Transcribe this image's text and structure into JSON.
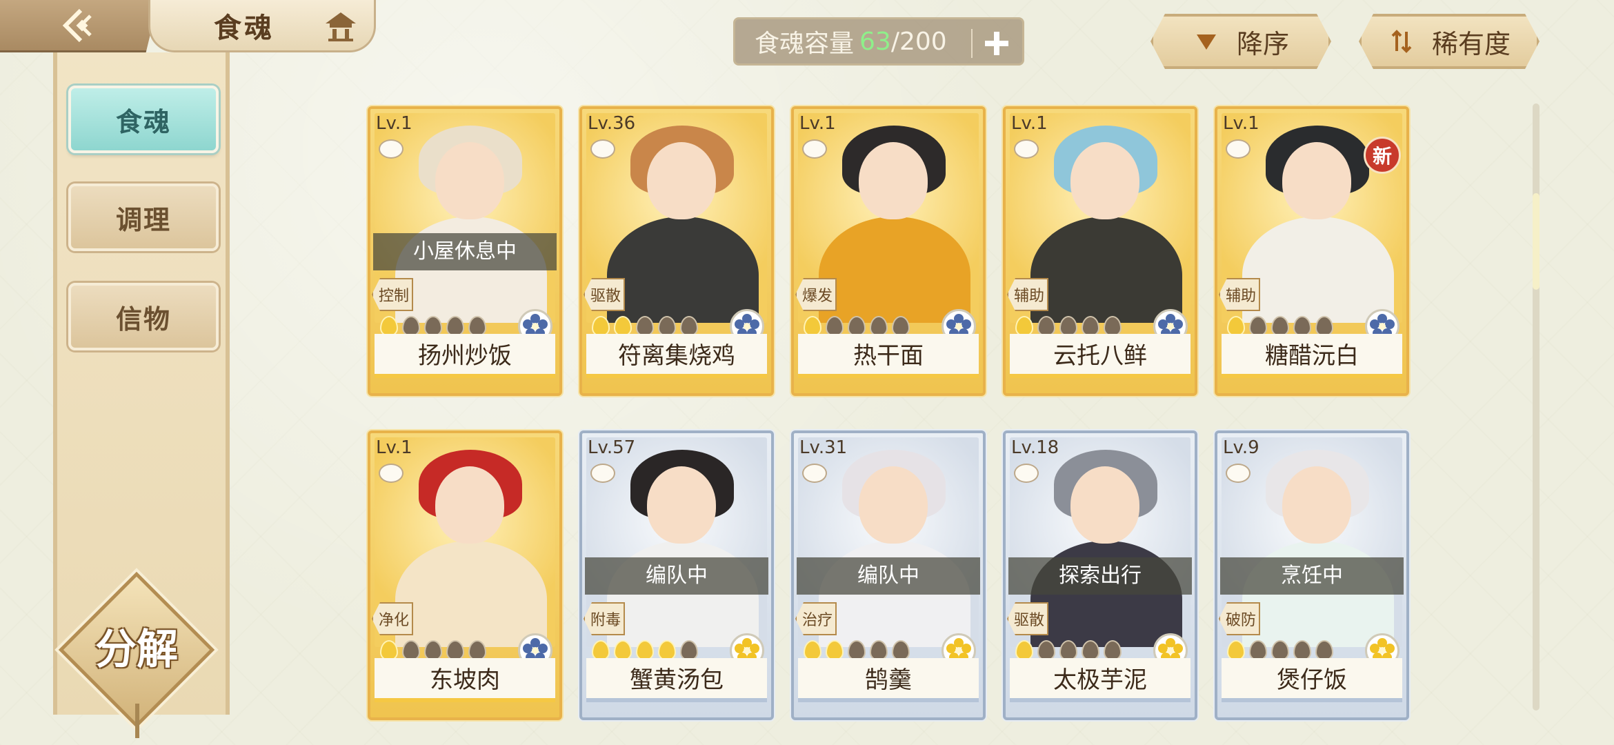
{
  "header": {
    "title": "食魂"
  },
  "sidebar": {
    "tabs": [
      {
        "label": "食魂",
        "active": true
      },
      {
        "label": "调理",
        "active": false
      },
      {
        "label": "信物",
        "active": false
      }
    ],
    "decompose_label": "分解"
  },
  "capacity": {
    "label": "食魂容量",
    "current": "63",
    "max": "/200"
  },
  "sort": {
    "order_label": "降序",
    "rarity_label": "稀有度"
  },
  "cards": [
    {
      "level": "Lv.1",
      "name": "扬州炒饭",
      "status": "小屋休息中",
      "role": "控制",
      "stars_on": 1,
      "frame": "gold",
      "element": "blue-flower",
      "is_new": false,
      "hair": "#eadfca",
      "body": "#f3ece0"
    },
    {
      "level": "Lv.36",
      "name": "符离集烧鸡",
      "status": "",
      "role": "驱散",
      "stars_on": 2,
      "frame": "gold",
      "element": "blue-flower",
      "is_new": false,
      "hair": "#c9864a",
      "body": "#3a3a38"
    },
    {
      "level": "Lv.1",
      "name": "热干面",
      "status": "",
      "role": "爆发",
      "stars_on": 1,
      "frame": "gold",
      "element": "blue-flower",
      "is_new": false,
      "hair": "#2d2a2a",
      "body": "#e8a326"
    },
    {
      "level": "Lv.1",
      "name": "云托八鲜",
      "status": "",
      "role": "辅助",
      "stars_on": 1,
      "frame": "gold",
      "element": "blue-flower",
      "is_new": false,
      "hair": "#8fc6da",
      "body": "#3b3a34"
    },
    {
      "level": "Lv.1",
      "name": "糖醋沅白",
      "status": "",
      "role": "辅助",
      "stars_on": 1,
      "frame": "gold",
      "element": "blue-flower",
      "is_new": true,
      "new_label": "新",
      "hair": "#2a2c2e",
      "body": "#f2efe7"
    },
    {
      "level": "Lv.1",
      "name": "东坡肉",
      "status": "",
      "role": "净化",
      "stars_on": 1,
      "frame": "gold",
      "element": "blue-flower",
      "is_new": false,
      "hair": "#c62a26",
      "body": "#f4e4c6"
    },
    {
      "level": "Lv.57",
      "name": "蟹黄汤包",
      "status": "编队中",
      "role": "附毒",
      "stars_on": 4,
      "frame": "silver",
      "element": "yellow-flower",
      "is_new": false,
      "hair": "#2a2626",
      "body": "#f0f0ef"
    },
    {
      "level": "Lv.31",
      "name": "鹄羹",
      "status": "编队中",
      "role": "治疗",
      "stars_on": 2,
      "frame": "silver",
      "element": "yellow-flower",
      "is_new": false,
      "hair": "#e6e2e6",
      "body": "#f0f0f2"
    },
    {
      "level": "Lv.18",
      "name": "太极芋泥",
      "status": "探索出行",
      "role": "驱散",
      "stars_on": 1,
      "frame": "silver",
      "element": "yellow-flower",
      "is_new": false,
      "hair": "#8b8f98",
      "body": "#3c3a46"
    },
    {
      "level": "Lv.9",
      "name": "煲仔饭",
      "status": "烹饪中",
      "role": "破防",
      "stars_on": 1,
      "frame": "silver",
      "element": "yellow-flower",
      "is_new": false,
      "hair": "#e8e6e8",
      "body": "#e9f3ef"
    }
  ]
}
